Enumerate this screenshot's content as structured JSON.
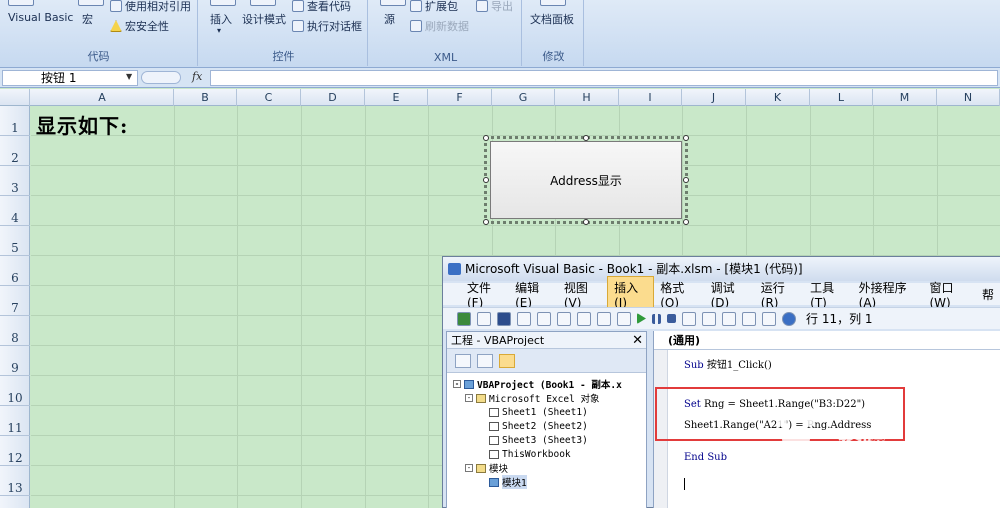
{
  "ribbon": {
    "groups": [
      {
        "label": "代码",
        "buttons": {
          "vb": "Visual Basic",
          "macro": "宏",
          "relative": "使用相对引用",
          "security": "宏安全性"
        }
      },
      {
        "label": "控件",
        "buttons": {
          "insert": "插入",
          "design": "设计模式",
          "view_code": "查看代码",
          "run_dialog": "执行对话框"
        }
      },
      {
        "label": "XML",
        "buttons": {
          "source": "源",
          "expand": "扩展包",
          "refresh": "刷新数据",
          "export": "导出"
        }
      },
      {
        "label": "修改",
        "buttons": {
          "doc_panel": "文档面板"
        }
      }
    ]
  },
  "formula_bar": {
    "name_box": "按钮 1",
    "fx": "fx",
    "value": ""
  },
  "grid": {
    "columns": [
      "A",
      "B",
      "C",
      "D",
      "E",
      "F",
      "G",
      "H",
      "I",
      "J",
      "K",
      "L",
      "M",
      "N"
    ],
    "rows": [
      "1",
      "2",
      "3",
      "4",
      "5",
      "6",
      "7",
      "8",
      "9",
      "10",
      "11",
      "12",
      "13"
    ],
    "cell_a1": "显示如下:"
  },
  "sheet_button": {
    "label": "Address显示"
  },
  "vba": {
    "title": "Microsoft Visual Basic - Book1 - 副本.xlsm - [模块1 (代码)]",
    "menu": [
      "文件(F)",
      "编辑(E)",
      "视图(V)",
      "插入(I)",
      "格式(O)",
      "调试(D)",
      "运行(R)",
      "工具(T)",
      "外接程序(A)",
      "窗口(W)",
      "帮"
    ],
    "active_menu": "插入(I)",
    "status": "行 11，列 1",
    "project": {
      "title": "工程 - VBAProject",
      "close": "✕",
      "tree": {
        "root": "VBAProject (Book1 - 副本.x",
        "excel_objects": "Microsoft Excel 对象",
        "sheet1": "Sheet1 (Sheet1)",
        "sheet2": "Sheet2 (Sheet2)",
        "sheet3": "Sheet3 (Sheet3)",
        "workbook": "ThisWorkbook",
        "modules": "模块",
        "module1": "模块1"
      }
    },
    "code": {
      "combo": "(通用)",
      "line_sub_kw": "Sub",
      "line_sub_rest": " 按钮1_Click()",
      "line_set_kw": "Set",
      "line_set_rest": " Rng = Sheet1.Range(\"B3:D22\")",
      "line_assign": "Sheet1.Range(\"A21\") = Rng.Address",
      "line_end_kw": "End Sub"
    }
  },
  "watermark": {
    "text": "经验",
    "url": "jingyan.baidu.com"
  },
  "colors": {
    "sheet_bg": "#c9e8c9",
    "highlight": "#e23b3b",
    "ribbon": "#dfeaf7"
  }
}
